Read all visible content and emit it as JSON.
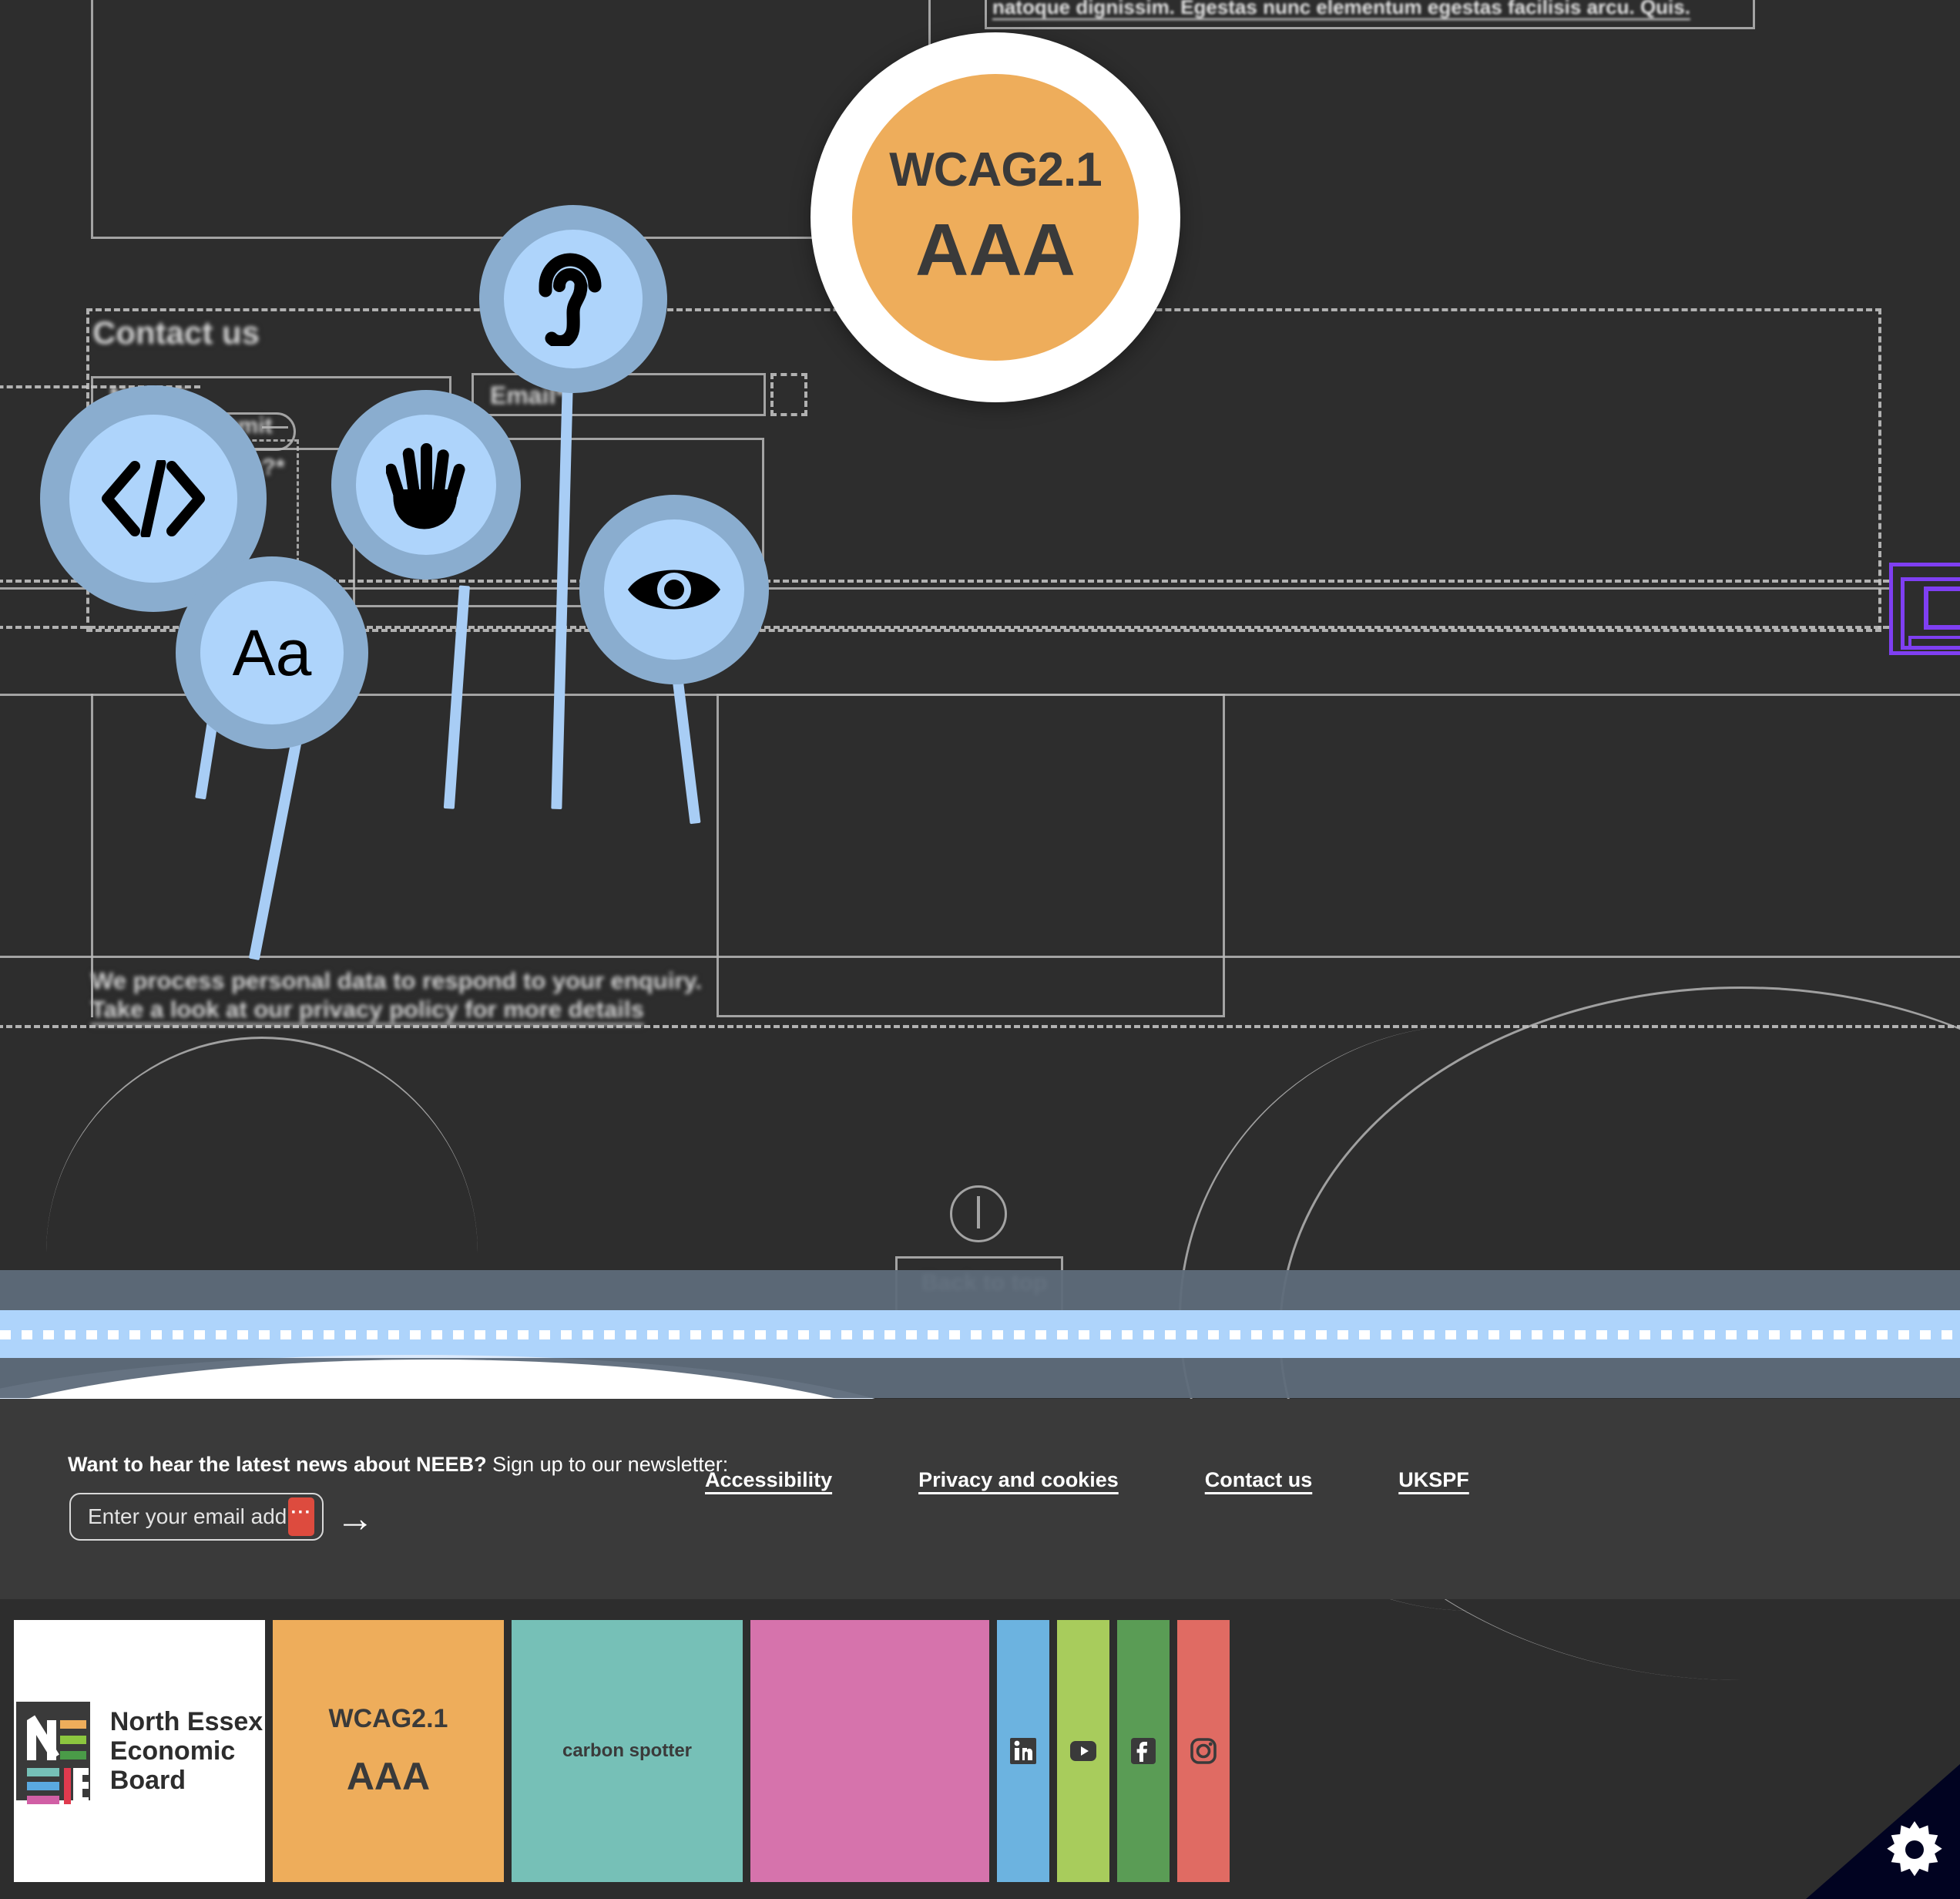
{
  "background": {
    "lorem_top": "natoque dignissim. Egestas nunc elementum egestas facilisis arcu. Quis.",
    "contact_heading": "Contact us",
    "field_name": "Name*",
    "field_email": "Email*",
    "field_help": "help?*",
    "submit_label": "Submit",
    "privacy_line1": "We process personal data to respond to your enquiry.",
    "privacy_line2": "Take a look at our privacy policy for more details",
    "back_to_top": "Back to top"
  },
  "wcag_badge": {
    "line1": "WCAG2.1",
    "line2": "AAA",
    "bg_color": "#eead5b",
    "ring_color": "#ffffff",
    "text_color": "#3a3a3a"
  },
  "accessibility_pins": [
    {
      "icon": "code-icon",
      "label": "Code / developer accessibility"
    },
    {
      "icon": "typography-icon",
      "label": "Aa typography"
    },
    {
      "icon": "hand-icon",
      "label": "Motor accessibility"
    },
    {
      "icon": "ear-icon",
      "label": "Hearing accessibility"
    },
    {
      "icon": "eye-icon",
      "label": "Vision accessibility"
    }
  ],
  "pin_colors": {
    "disc": "#aed4fb",
    "halo": "#8aadcf",
    "stem": "#a8cdf5",
    "glyph": "#000000"
  },
  "footer": {
    "newsletter_prompt_bold": "Want to hear the latest news about NEEB?",
    "newsletter_prompt_rest": " Sign up to our newsletter:",
    "email_placeholder": "Enter your email address",
    "email_value": "",
    "submit_arrow": "→",
    "links": [
      {
        "label": "Accessibility"
      },
      {
        "label": "Privacy and cookies"
      },
      {
        "label": "Contact us"
      },
      {
        "label": "UKSPF"
      }
    ]
  },
  "badges": {
    "neeb": {
      "line1": "North Essex",
      "line2": "Economic",
      "line3": "Board",
      "bg": "#ffffff"
    },
    "logo_bar_colors": [
      "#eead5b",
      "#8cc63f",
      "#4a9b48",
      "#76c0b7",
      "#5aa9e0",
      "#d15fa5"
    ],
    "logo_accent_red": "#e03a4e",
    "wcag": {
      "line1": "WCAG2.1",
      "line2": "AAA",
      "bg": "#eead5b"
    },
    "carbon": {
      "label": "carbon spotter",
      "bg": "#76c0b7"
    },
    "pink": {
      "label": "",
      "bg": "#d673ac"
    },
    "socials": [
      {
        "name": "linkedin-icon",
        "bg": "#6cb3e0"
      },
      {
        "name": "youtube-icon",
        "bg": "#a8cc5c"
      },
      {
        "name": "facebook-icon",
        "bg": "#5a9c55"
      },
      {
        "name": "instagram-icon",
        "bg": "#e06b63"
      }
    ]
  },
  "settings_corner": {
    "icon": "gear-icon",
    "bg": "#010321"
  }
}
